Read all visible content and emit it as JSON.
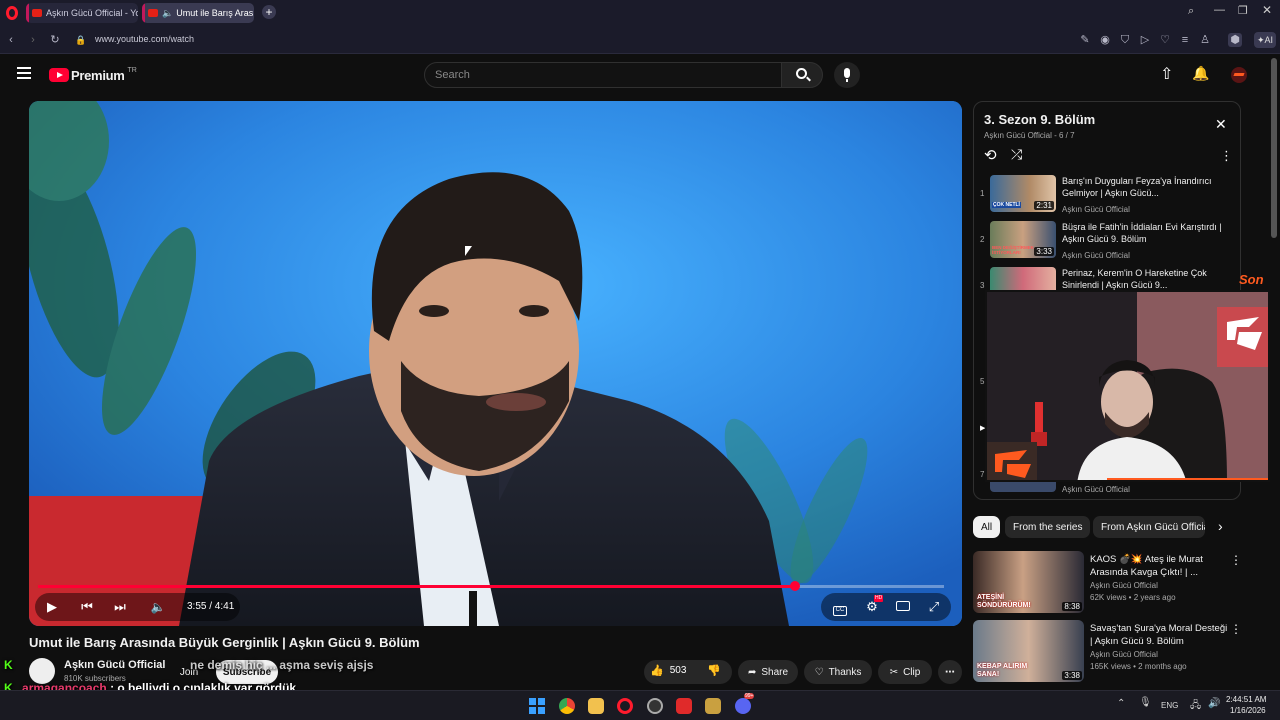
{
  "browser": {
    "tabs": [
      {
        "label": "Aşkın Gücü Official - YouTube",
        "active": false
      },
      {
        "label": "Umut ile Barış Arasında",
        "active": true
      }
    ],
    "url": "www.youtube.com/watch",
    "ai_label": "AI"
  },
  "yt": {
    "logo_text": "Premium",
    "logo_region": "TR",
    "search_placeholder": "Search"
  },
  "player": {
    "time": "3:55 / 4:41",
    "progress": 0.836,
    "hd_badge": "HD"
  },
  "video": {
    "title": "Umut ile Barış Arasında Büyük Gerginlik | Aşkın Gücü 9. Bölüm",
    "channel": "Aşkın Gücü Official",
    "subscribers": "810K subscribers",
    "join": "Join",
    "subscribe": "Subscribe",
    "likes": "503",
    "share": "Share",
    "thanks": "Thanks",
    "clip": "Clip"
  },
  "playlist": {
    "title": "3. Sezon 9. Bölüm",
    "subtitle_channel": "Aşkın Gücü Official",
    "subtitle_pos": "- 6 / 7",
    "items": [
      {
        "index": "1",
        "title": "Barış'ın Duyguları Feyza'ya İnandırıcı Gelmiyor | Aşkın Gücü...",
        "channel": "Aşkın Gücü Official",
        "duration": "2:31",
        "thumb_text": "ÇOK NETLİ"
      },
      {
        "index": "2",
        "title": "Büşra ile Fatih'in İddiaları Evi Karıştırdı | Aşkın Gücü 9. Bölüm",
        "channel": "Aşkın Gücü Official",
        "duration": "3:33",
        "thumb_text": "BEN DEĞİŞTİRMEK İSTİYORLAR!"
      },
      {
        "index": "3",
        "title": "Perinaz, Kerem'in O Hareketine Çok Sinirlendi | Aşkın Gücü 9...",
        "channel": "",
        "duration": "",
        "thumb_text": ""
      }
    ],
    "hidden_indices": [
      "5",
      "7"
    ],
    "last_channel": "Aşkın Gücü Official"
  },
  "chips": [
    "All",
    "From the series",
    "From Aşkın Gücü Official"
  ],
  "recommendations": [
    {
      "title": "KAOS 💣💥 Ateş ile Murat Arasında Kavga Çıktı! | ...",
      "channel": "Aşkın Gücü Official",
      "meta": "62K views • 2 years ago",
      "duration": "8:38",
      "thumb_text": "ATEŞİNİ SÖNDÜRÜRÜM!"
    },
    {
      "title": "Savaş'tan Şura'ya Moral Desteği | Aşkın Gücü 9. Bölüm",
      "channel": "Aşkın Gücü Official",
      "meta": "165K views • 2 months ago",
      "duration": "3:38",
      "thumb_text": "KEBAP ALIRIM SANA!"
    }
  ],
  "overlay": {
    "side_text": "Son",
    "chat": [
      {
        "user": "",
        "text": "ne demiş hiç ... aşma seviş ajsjs"
      },
      {
        "user": "armagancoach",
        "text": ": o belliydi o çıplaklık var gördük"
      }
    ]
  },
  "taskbar": {
    "lang": "ENG",
    "time": "2:44:51 AM",
    "date": "1/16/2026",
    "badge": "99+"
  },
  "colors": {
    "yt_red": "#ff0033",
    "opera_red": "#ff1b2d",
    "chat_user": "#e83a6b",
    "kick_green": "#53fc18",
    "streamer_orange": "#ff5a1f"
  }
}
